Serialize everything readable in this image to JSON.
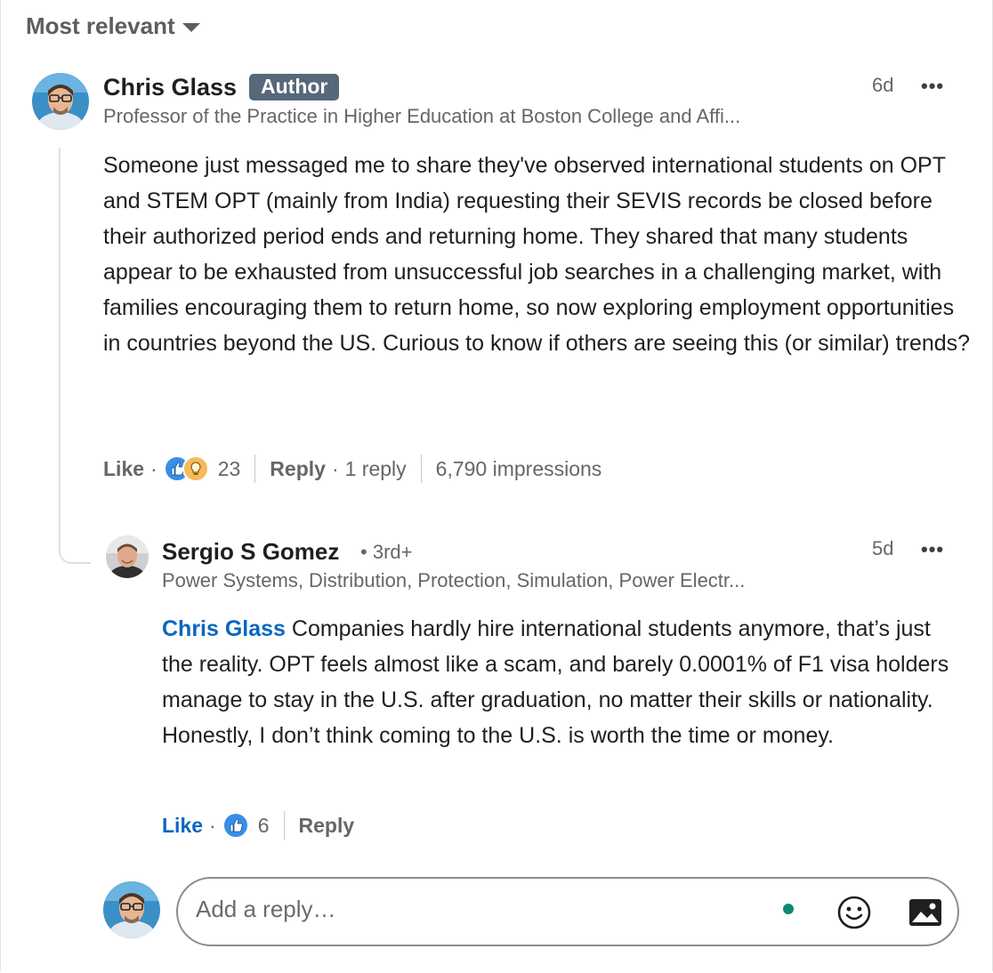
{
  "sort": {
    "label": "Most relevant",
    "icon": "caret-down-icon"
  },
  "comment": {
    "author": "Chris Glass",
    "badge": "Author",
    "headline": "Professor of the Practice in Higher Education at Boston College and Affi...",
    "time": "6d",
    "more": "•••",
    "text": "Someone just messaged me to share they've observed international students on OPT and STEM OPT (mainly from India) requesting their SEVIS records be closed before their authorized period ends and returning home. They shared that many students appear to be exhausted from unsuccessful job searches in a challenging market, with families encouraging them to return home, so now exploring employment opportunities in countries beyond the US. Curious to know if others are seeing this (or similar) trends?",
    "actions": {
      "like": "Like",
      "reaction_count": "23",
      "reply": "Reply",
      "reply_count": "1 reply",
      "impressions": "6,790 impressions"
    },
    "reaction_icons": [
      "like-icon",
      "insightful-icon"
    ]
  },
  "reply": {
    "author": "Sergio S Gomez",
    "degree": "3rd+",
    "headline": "Power Systems, Distribution, Protection, Simulation, Power Electr...",
    "time": "5d",
    "more": "•••",
    "mention": "Chris Glass",
    "text": " Companies hardly hire international students anymore, that’s just the reality. OPT feels almost like a scam, and barely 0.0001% of F1 visa holders manage to stay in the U.S. after graduation, no matter their skills or nationality. Honestly, I don’t think coming to the U.S. is worth the time or money.",
    "actions": {
      "like": "Like",
      "reaction_count": "6",
      "reply": "Reply"
    },
    "reaction_icons": [
      "like-icon"
    ]
  },
  "composer": {
    "placeholder": "Add a reply…",
    "emoji_icon": "emoji-icon",
    "image_icon": "image-icon"
  },
  "colors": {
    "link_blue": "#0a66c2",
    "badge_bg": "#56687a",
    "presence_green": "#0e8a73"
  }
}
